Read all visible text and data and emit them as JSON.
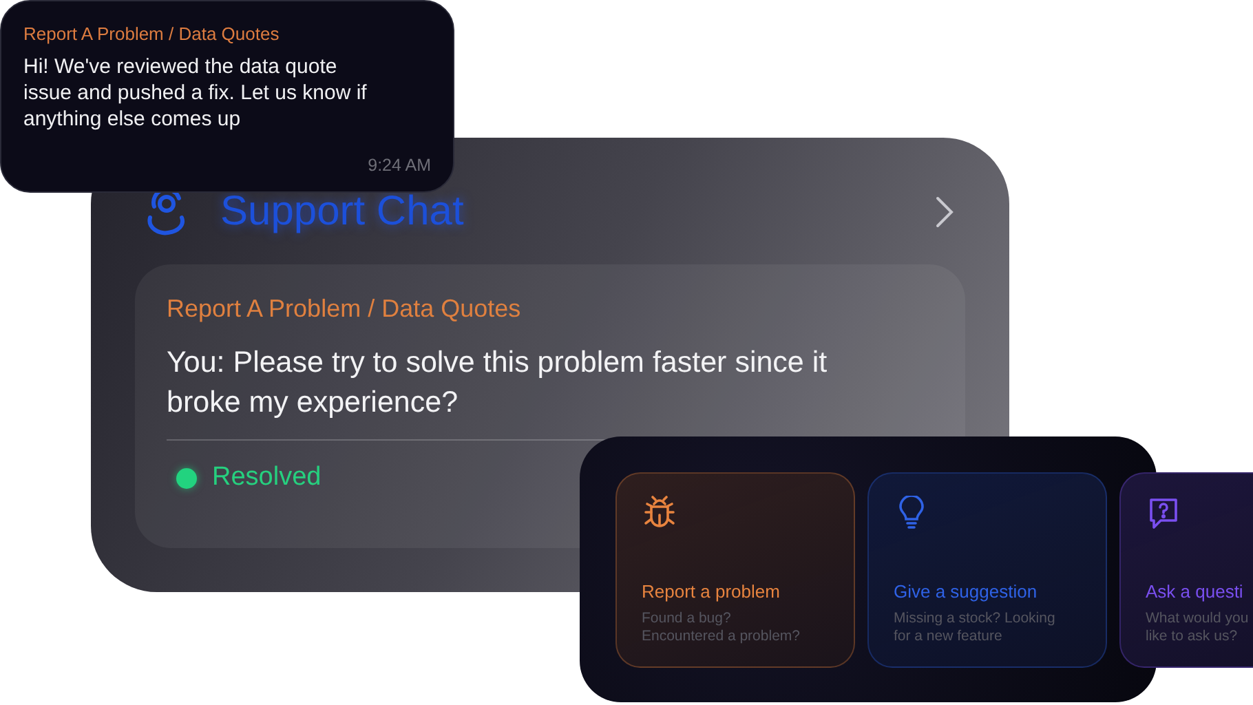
{
  "notification": {
    "category": "Report A Problem / Data Quotes",
    "message": "Hi! We've reviewed the data quote issue and pushed a fix. Let us know if anything else comes up",
    "time": "9:24 AM"
  },
  "support_chat": {
    "title": "Support Chat",
    "ticket": {
      "category": "Report A Problem / Data Quotes",
      "message": "You: Please try to solve this problem faster since it broke my experience?",
      "status": {
        "label": "Resolved",
        "resolved": true
      }
    }
  },
  "options": [
    {
      "kind": "bug",
      "title": "Report a problem",
      "description": [
        "Found a bug?",
        "Encountered a problem?"
      ],
      "color": "#e8843f"
    },
    {
      "kind": "bulb",
      "title": "Give a suggestion",
      "description": [
        "Missing a stock? Looking",
        "for a new feature"
      ],
      "color": "#2f62e6"
    },
    {
      "kind": "question",
      "title": "Ask a questi",
      "description": [
        "What would you",
        "like to ask us?"
      ],
      "color": "#7a4ff0"
    }
  ]
}
